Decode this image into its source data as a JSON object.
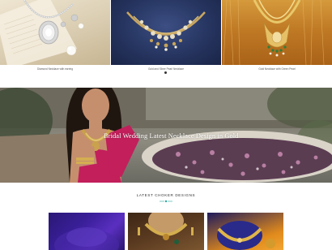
{
  "products": [
    {
      "caption": "Diamond Necklace with earring",
      "image": "diamond-necklace-photo"
    },
    {
      "caption": "Gold and Silver Pearl Necklace",
      "image": "pearl-necklace-photo"
    },
    {
      "caption": "Gold Necklace with Green Pearl",
      "image": "green-pearl-necklace-photo"
    }
  ],
  "banner": {
    "title": "Bridal Wedding Latest Necklace Design in Gold",
    "image": "bride-at-fountain-photo"
  },
  "choker_section": {
    "heading": "LATEST CHOKER DESIGNS",
    "items": [
      {
        "image": "purple-choker-photo"
      },
      {
        "image": "gold-choker-photo"
      },
      {
        "image": "blue-gold-choker-photo"
      }
    ]
  },
  "colors": {
    "accent": "#2aa8a0",
    "heading_text": "#333333",
    "banner_text": "#ffffff"
  },
  "icons": [
    "carousel-dot-icon",
    "heading-ornament-icon"
  ]
}
